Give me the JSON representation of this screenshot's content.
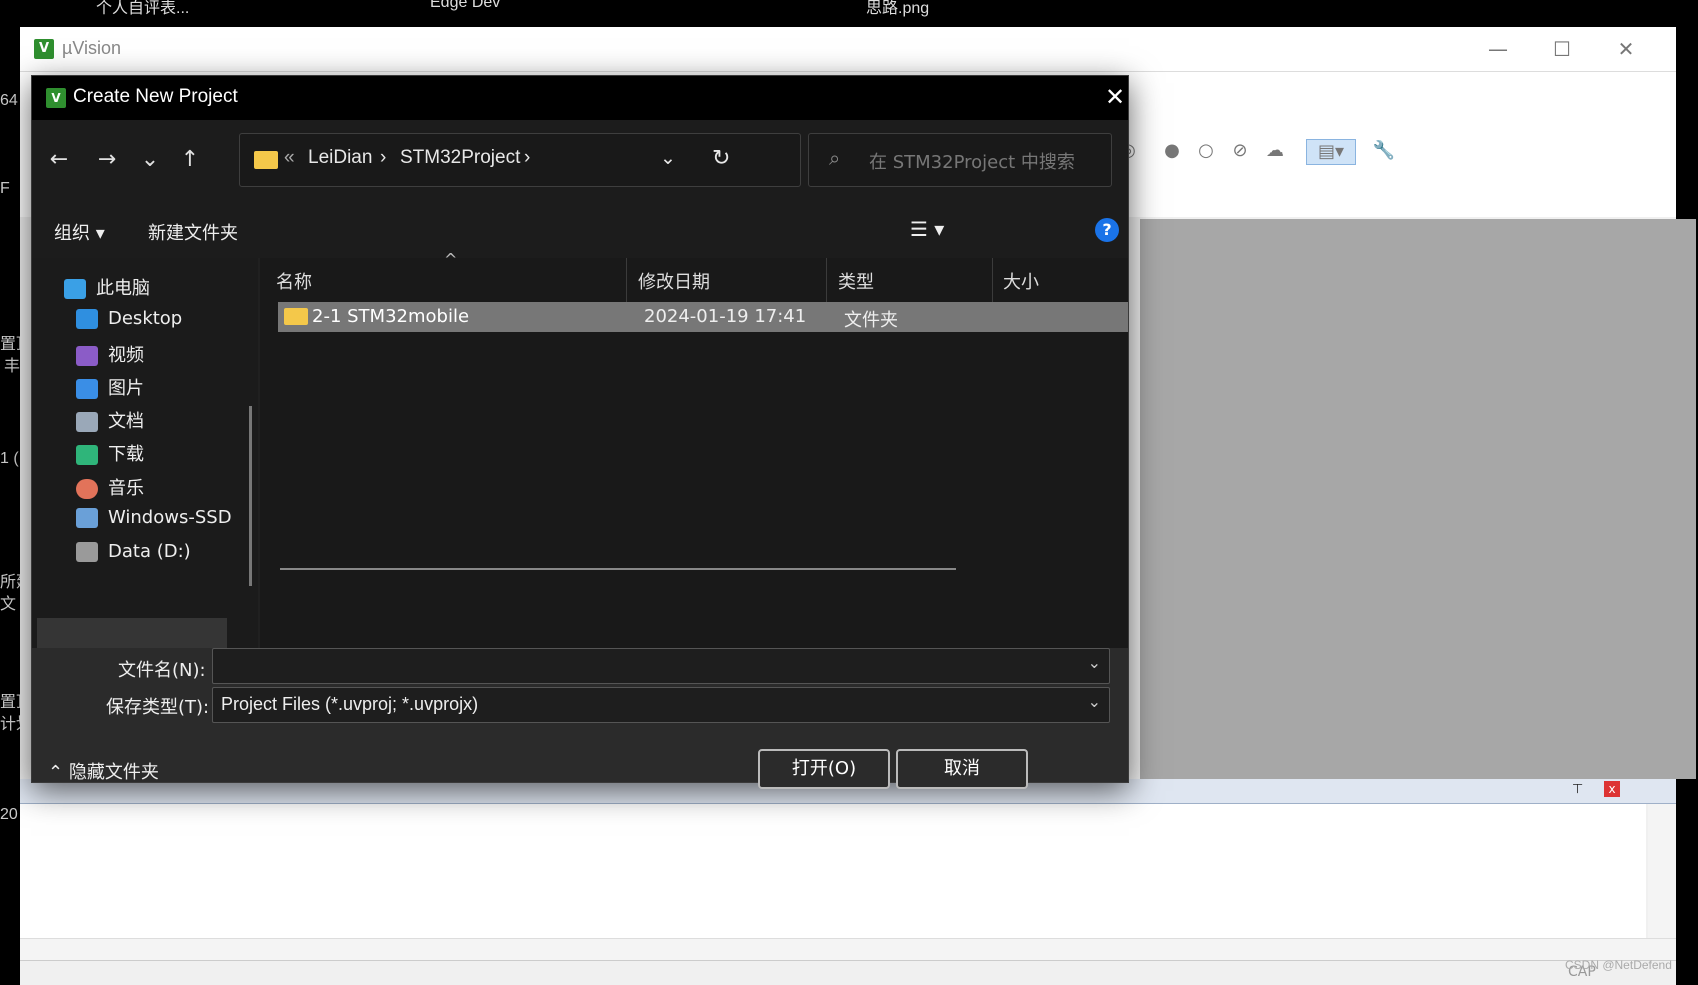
{
  "desktop": {
    "top_titles": [
      "个人自评表...",
      "Edge Dev",
      "思路.png"
    ],
    "left_fragments": [
      "64",
      "F",
      "置顶",
      "丰",
      "1 (",
      "所建",
      "文",
      "置顶",
      "计划",
      "20"
    ]
  },
  "uvision": {
    "title": "µVision",
    "logo": "V",
    "window_buttons": {
      "minimize": "—",
      "maximize": "☐",
      "close": "✕"
    },
    "status_cap": "CAP"
  },
  "dialog": {
    "title": "Create New Project",
    "logo": "V",
    "close": "✕",
    "nav": {
      "back": "←",
      "forward": "→",
      "recent": "⌄",
      "up": "↑",
      "refresh": "↻"
    },
    "address": {
      "prefix": "«",
      "crumbs": [
        "LeiDian",
        "STM32Project"
      ],
      "separator": "›",
      "dropdown": "⌄"
    },
    "search": {
      "icon": "⌕",
      "placeholder": "在 STM32Project 中搜索"
    },
    "commands": {
      "organize": "组织 ▾",
      "new_folder": "新建文件夹",
      "view": "☰ ▾",
      "help": "?"
    },
    "tree": [
      {
        "label": "此电脑",
        "icon": "pc-icon",
        "color": "#3aa0e6"
      },
      {
        "label": "Desktop",
        "icon": "desktop-icon",
        "color": "#2f8fe0"
      },
      {
        "label": "视频",
        "icon": "video-icon",
        "color": "#8b5cc7"
      },
      {
        "label": "图片",
        "icon": "picture-icon",
        "color": "#3a8ee6"
      },
      {
        "label": "文档",
        "icon": "document-icon",
        "color": "#9aa8b8"
      },
      {
        "label": "下载",
        "icon": "download-icon",
        "color": "#2fb57a"
      },
      {
        "label": "音乐",
        "icon": "music-icon",
        "color": "#e2735a"
      },
      {
        "label": "Windows-SSD",
        "icon": "drive-icon",
        "color": "#6aa0d8"
      },
      {
        "label": "Data (D:)",
        "icon": "drive-icon",
        "color": "#9a9a9a"
      }
    ],
    "columns": {
      "name": "名称",
      "date": "修改日期",
      "type": "类型",
      "size": "大小"
    },
    "sort_indicator": "^",
    "files": [
      {
        "name": "2-1 STM32mobile",
        "date": "2024-01-19 17:41",
        "type": "文件夹"
      }
    ],
    "filename_label": "文件名(N):",
    "filename_value": "",
    "filetype_label": "保存类型(T):",
    "filetype_value": "Project Files (*.uvproj; *.uvprojx)",
    "hide_folders": "隐藏文件夹",
    "open_button": "打开(O)",
    "cancel_button": "取消"
  },
  "watermark": "CSDN @NetDefend"
}
